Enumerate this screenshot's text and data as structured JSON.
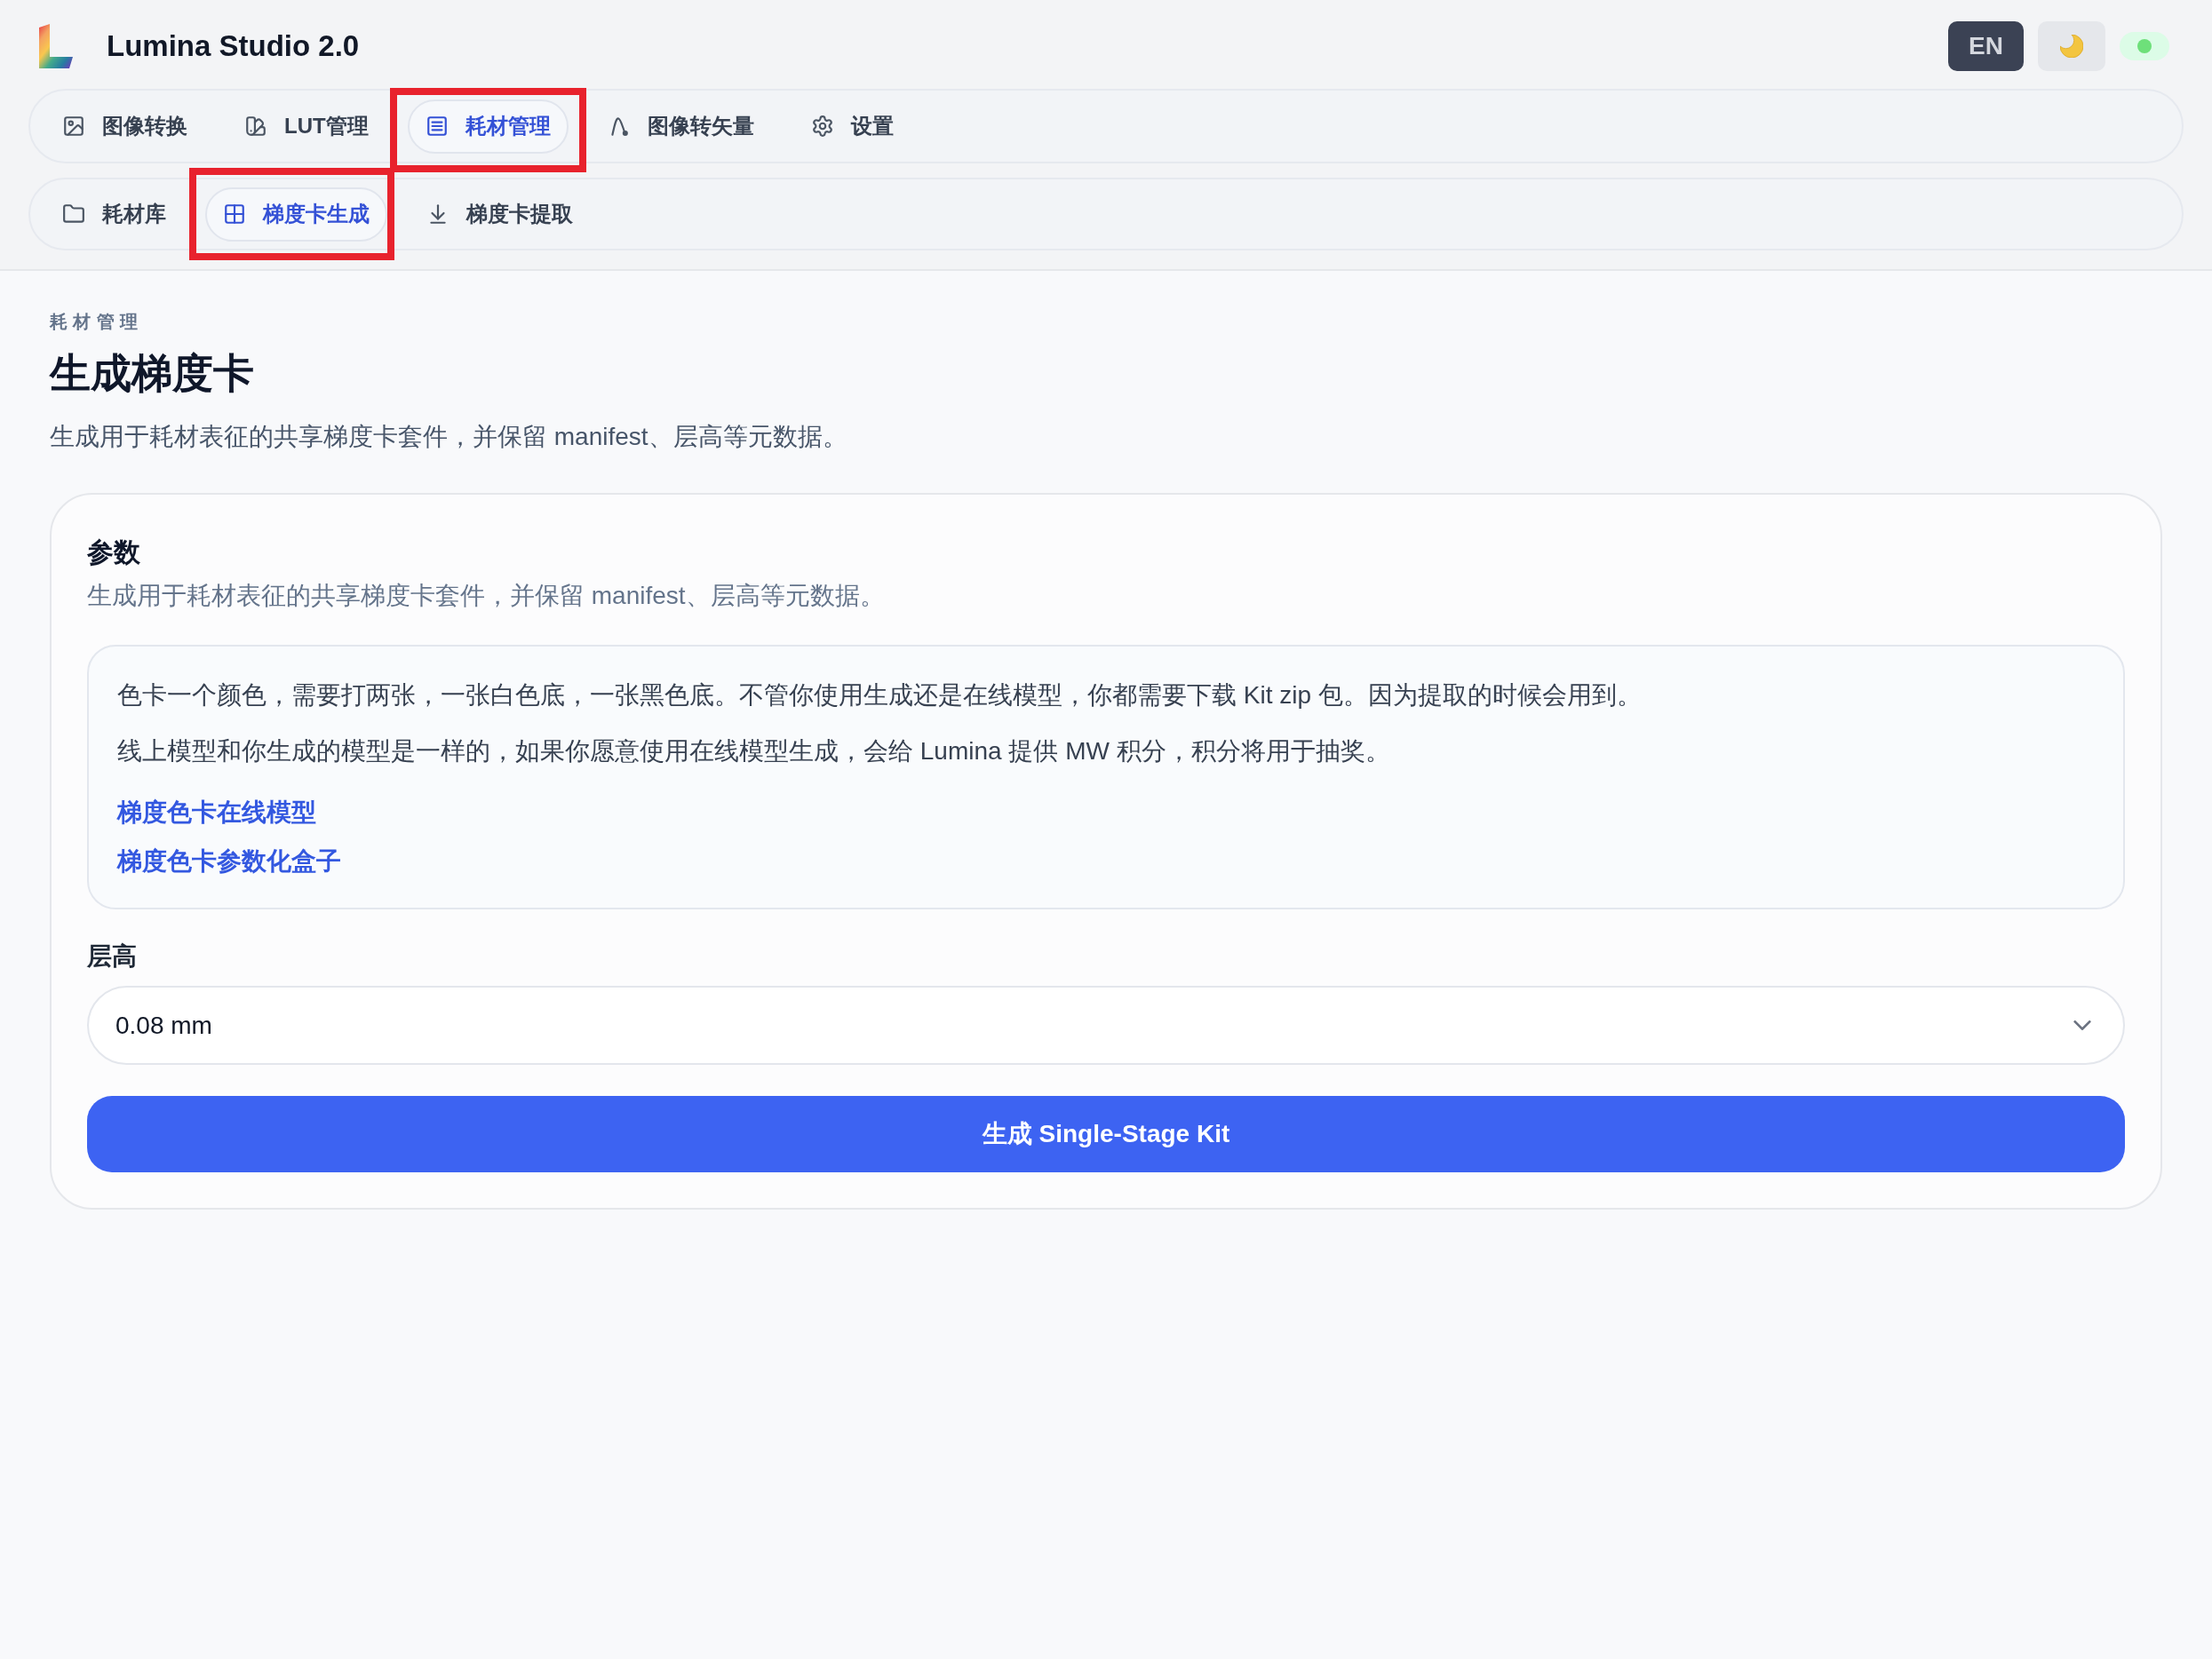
{
  "app": {
    "title": "Lumina Studio 2.0"
  },
  "header_actions": {
    "language_button": "EN",
    "status": {
      "online": true
    }
  },
  "main_nav": [
    {
      "label": "图像转换",
      "selected": false,
      "highlighted": false
    },
    {
      "label": "LUT管理",
      "selected": false,
      "highlighted": false
    },
    {
      "label": "耗材管理",
      "selected": true,
      "highlighted": true
    },
    {
      "label": "图像转矢量",
      "selected": false,
      "highlighted": false
    },
    {
      "label": "设置",
      "selected": false,
      "highlighted": false
    }
  ],
  "sub_nav": [
    {
      "label": "耗材库",
      "selected": false,
      "highlighted": false
    },
    {
      "label": "梯度卡生成",
      "selected": true,
      "highlighted": true
    },
    {
      "label": "梯度卡提取",
      "selected": false,
      "highlighted": false
    }
  ],
  "page": {
    "eyebrow": "耗材管理",
    "title": "生成梯度卡",
    "description": "生成用于耗材表征的共享梯度卡套件，并保留 manifest、层高等元数据。"
  },
  "params_card": {
    "title": "参数",
    "description": "生成用于耗材表征的共享梯度卡套件，并保留 manifest、层高等元数据。",
    "notice": {
      "paragraphs": [
        "色卡一个颜色，需要打两张，一张白色底，一张黑色底。不管你使用生成还是在线模型，你都需要下载 Kit zip 包。因为提取的时候会用到。",
        "线上模型和你生成的模型是一样的，如果你愿意使用在线模型生成，会给 Lumina 提供 MW 积分，积分将用于抽奖。"
      ],
      "links": [
        "梯度色卡在线模型",
        "梯度色卡参数化盒子"
      ]
    },
    "layer_height": {
      "label": "层高",
      "value": "0.08 mm"
    },
    "submit_button": "生成 Single-Stage Kit"
  }
}
